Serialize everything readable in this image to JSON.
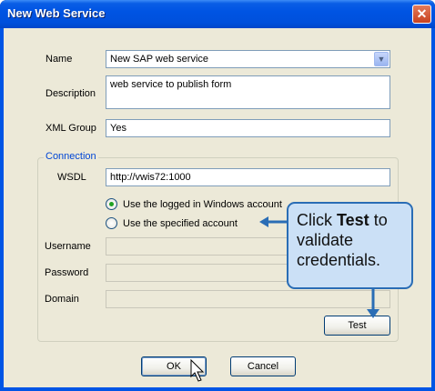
{
  "window": {
    "title": "New Web Service",
    "close_glyph": "✕"
  },
  "form": {
    "name_label": "Name",
    "name_value": "New SAP web service",
    "description_label": "Description",
    "description_value": "web service to publish form",
    "xml_group_label": "XML Group",
    "xml_group_value": "Yes"
  },
  "connection": {
    "legend": "Connection",
    "wsdl_label": "WSDL",
    "wsdl_value": "http://vwis72:1000",
    "radio_windows_label": "Use the logged in Windows account",
    "radio_windows_checked": true,
    "radio_specified_label": "Use the specified account",
    "radio_specified_checked": false,
    "username_label": "Username",
    "password_label": "Password",
    "domain_label": "Domain",
    "test_button": "Test"
  },
  "buttons": {
    "ok": "OK",
    "cancel": "Cancel"
  },
  "callout": {
    "prefix": "Click ",
    "bold": "Test",
    "suffix": " to validate credentials."
  },
  "colors": {
    "accent": "#0054e3",
    "callout_fill": "#cbe0f6",
    "callout_border": "#2a6db5"
  }
}
